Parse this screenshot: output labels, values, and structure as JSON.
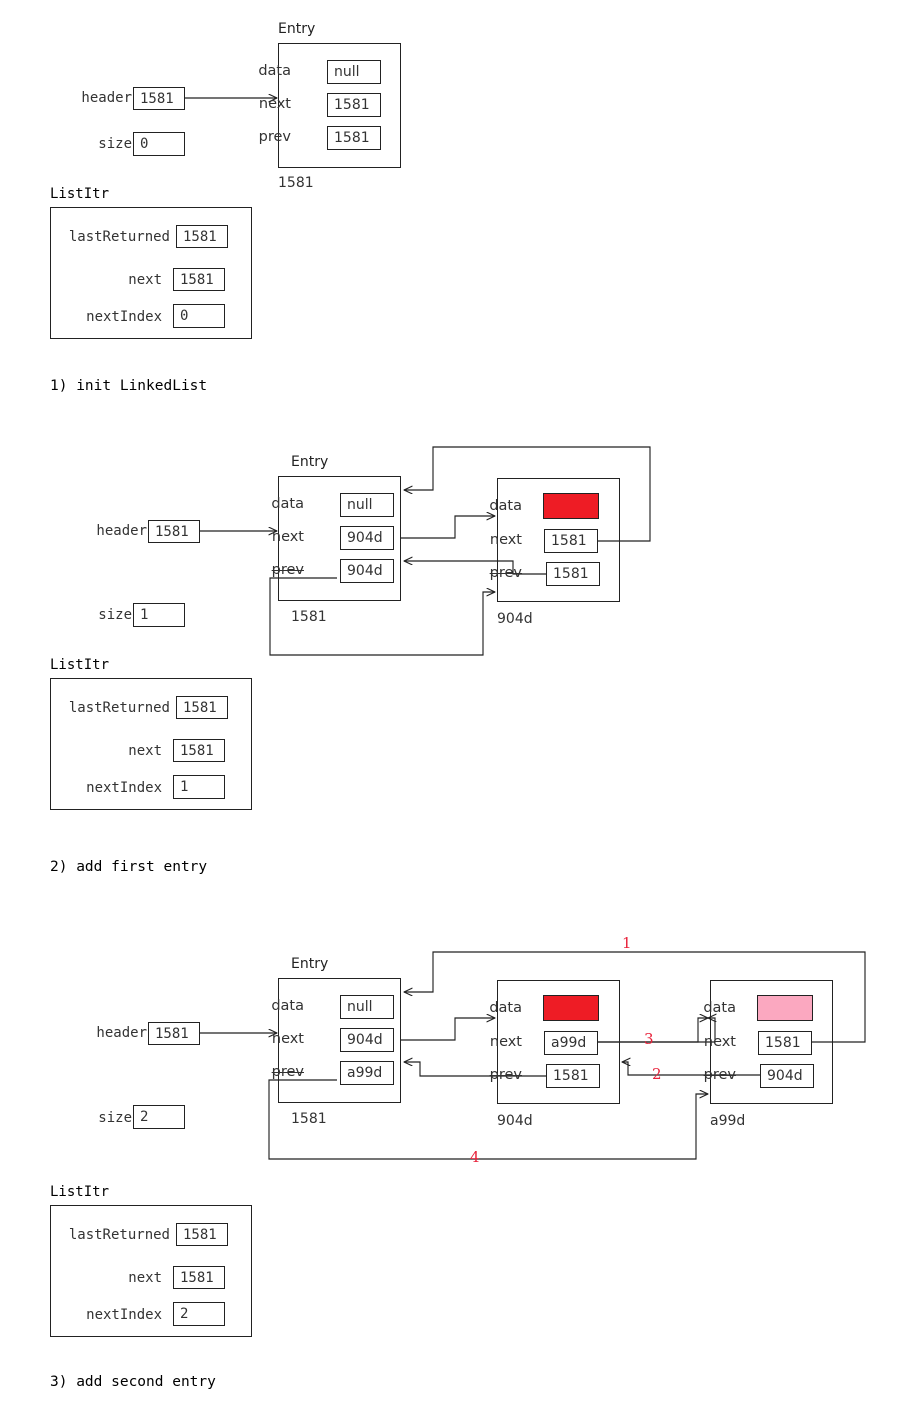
{
  "diagram": {
    "title": "Java LinkedList internal structure walkthrough",
    "colors": {
      "stroke": "#222222",
      "red_data": "#ee1c25",
      "pink_data": "#fba8c0",
      "red_number": "#e8213a"
    }
  },
  "sections": [
    {
      "id": "step1",
      "caption": "1) init LinkedList",
      "list": {
        "header_label": "header",
        "header_value": "1581",
        "size_label": "size",
        "size_value": "0"
      },
      "entry_title": "Entry",
      "nodes": [
        {
          "address": "1581",
          "fields": [
            {
              "label": "data",
              "value": "null",
              "struck": false,
              "swatch": null
            },
            {
              "label": "next",
              "value": "1581",
              "struck": false,
              "swatch": null
            },
            {
              "label": "prev",
              "value": "1581",
              "struck": false,
              "swatch": null
            }
          ]
        }
      ],
      "iterator": {
        "title": "ListItr",
        "fields": [
          {
            "label": "lastReturned",
            "value": "1581"
          },
          {
            "label": "next",
            "value": "1581"
          },
          {
            "label": "nextIndex",
            "value": "0"
          }
        ]
      }
    },
    {
      "id": "step2",
      "caption": "2) add first entry",
      "list": {
        "header_label": "header",
        "header_value": "1581",
        "size_label": "size",
        "size_value": "1"
      },
      "entry_title": "Entry",
      "nodes": [
        {
          "address": "1581",
          "fields": [
            {
              "label": "data",
              "value": "null",
              "struck": false,
              "swatch": null
            },
            {
              "label": "next",
              "value": "904d",
              "struck": false,
              "swatch": null
            },
            {
              "label": "prev",
              "value": "904d",
              "struck": true,
              "swatch": null
            }
          ]
        },
        {
          "address": "904d",
          "fields": [
            {
              "label": "data",
              "value": "",
              "struck": false,
              "swatch": "#ee1c25"
            },
            {
              "label": "next",
              "value": "1581",
              "struck": false,
              "swatch": null
            },
            {
              "label": "prev",
              "value": "1581",
              "struck": true,
              "swatch": null
            }
          ]
        }
      ],
      "iterator": {
        "title": "ListItr",
        "fields": [
          {
            "label": "lastReturned",
            "value": "1581"
          },
          {
            "label": "next",
            "value": "1581"
          },
          {
            "label": "nextIndex",
            "value": "1"
          }
        ]
      }
    },
    {
      "id": "step3",
      "caption": "3) add second entry",
      "list": {
        "header_label": "header",
        "header_value": "1581",
        "size_label": "size",
        "size_value": "2"
      },
      "entry_title": "Entry",
      "nodes": [
        {
          "address": "1581",
          "fields": [
            {
              "label": "data",
              "value": "null",
              "struck": false,
              "swatch": null
            },
            {
              "label": "next",
              "value": "904d",
              "struck": false,
              "swatch": null
            },
            {
              "label": "prev",
              "value": "a99d",
              "struck": true,
              "swatch": null
            }
          ]
        },
        {
          "address": "904d",
          "fields": [
            {
              "label": "data",
              "value": "",
              "struck": false,
              "swatch": "#ee1c25"
            },
            {
              "label": "next",
              "value": "a99d",
              "struck": false,
              "swatch": null
            },
            {
              "label": "prev",
              "value": "1581",
              "struck": true,
              "swatch": null
            }
          ]
        },
        {
          "address": "a99d",
          "fields": [
            {
              "label": "data",
              "value": "",
              "struck": false,
              "swatch": "#fba8c0"
            },
            {
              "label": "next",
              "value": "1581",
              "struck": false,
              "swatch": null
            },
            {
              "label": "prev",
              "value": "904d",
              "struck": true,
              "swatch": null
            }
          ]
        }
      ],
      "link_numbers": [
        "1",
        "2",
        "3",
        "4"
      ],
      "iterator": {
        "title": "ListItr",
        "fields": [
          {
            "label": "lastReturned",
            "value": "1581"
          },
          {
            "label": "next",
            "value": "1581"
          },
          {
            "label": "nextIndex",
            "value": "2"
          }
        ]
      }
    }
  ]
}
